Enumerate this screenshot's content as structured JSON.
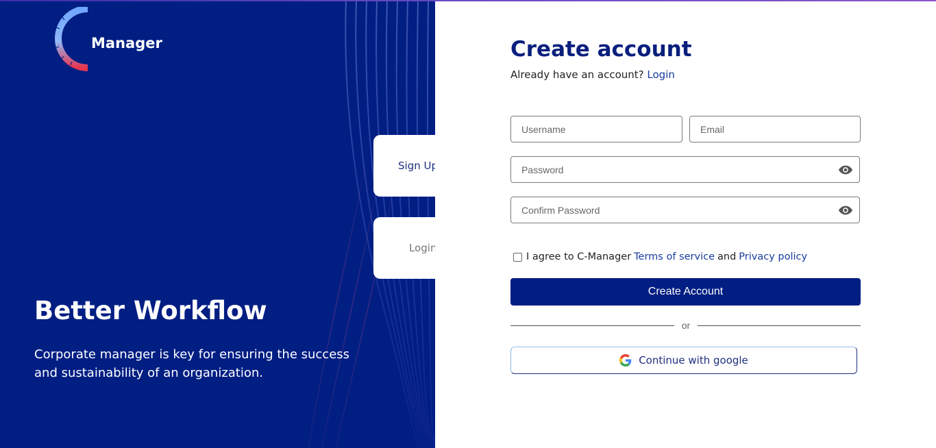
{
  "brand": {
    "logo_icon": "c-logo-icon",
    "name": "Manager"
  },
  "hero": {
    "title": "Better Workflow",
    "subtitle": "Corporate manager is key for ensuring the success and sustainability of an organization."
  },
  "side_tabs": {
    "signup_label": "Sign Up",
    "login_label": "Login"
  },
  "form": {
    "title": "Create account",
    "have_account_text": "Already have an account?",
    "login_link": "Login",
    "username_placeholder": "Username",
    "email_placeholder": "Email",
    "password_placeholder": "Password",
    "confirm_placeholder": "Confirm Password",
    "agree_text": "I agree to C-Manager",
    "terms_link": "Terms of service",
    "and_text": "and",
    "privacy_link": "Privacy policy",
    "agree_checked": false,
    "create_button": "Create Account",
    "or_text": "or",
    "google_button": "Continue with google"
  },
  "colors": {
    "primary": "#011e83",
    "title": "#0a1f7d",
    "link": "#173a9e",
    "white": "#ffffff"
  }
}
